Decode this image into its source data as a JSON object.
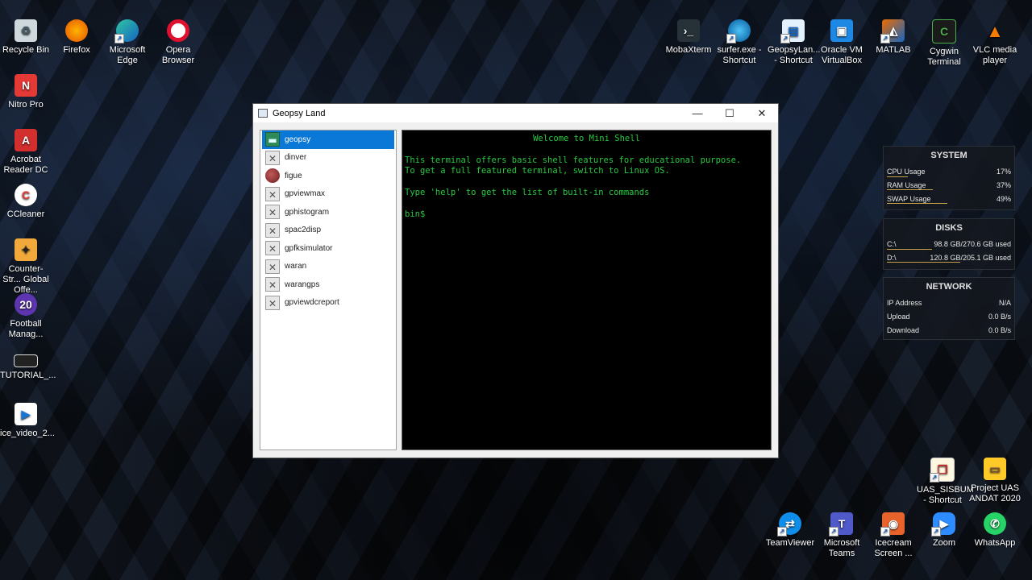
{
  "desktop_left": [
    {
      "label": "Recycle Bin",
      "icon": "recycle-bin-icon"
    },
    {
      "label": "Firefox",
      "icon": "firefox-icon"
    },
    {
      "label": "Microsoft Edge",
      "icon": "edge-icon"
    },
    {
      "label": "Opera Browser",
      "icon": "opera-icon"
    },
    {
      "label": "Nitro Pro",
      "icon": "nitro-icon"
    },
    {
      "label": "Acrobat Reader DC",
      "icon": "acrobat-icon"
    },
    {
      "label": "CCleaner",
      "icon": "ccleaner-icon"
    },
    {
      "label": "Counter-Str... Global Offe...",
      "icon": "csgo-icon"
    },
    {
      "label": "Football Manag...",
      "icon": "football-manager-icon"
    },
    {
      "label": "TUTORIAL_...",
      "icon": "video-file-icon"
    },
    {
      "label": "ice_video_2...",
      "icon": "video-file-icon"
    }
  ],
  "desktop_right": [
    {
      "label": "MobaXterm",
      "icon": "mobaxterm-icon"
    },
    {
      "label": "surfer.exe - Shortcut",
      "icon": "surfer-icon"
    },
    {
      "label": "GeopsyLan... - Shortcut",
      "icon": "geopsy-icon"
    },
    {
      "label": "Oracle VM VirtualBox",
      "icon": "virtualbox-icon"
    },
    {
      "label": "MATLAB",
      "icon": "matlab-icon"
    },
    {
      "label": "Cygwin Terminal",
      "icon": "cygwin-icon"
    },
    {
      "label": "VLC media player",
      "icon": "vlc-icon"
    },
    {
      "label": "UAS_SISBUM - Shortcut",
      "icon": "document-icon"
    },
    {
      "label": "Project UAS ANDAT 2020",
      "icon": "folder-icon"
    },
    {
      "label": "TeamViewer",
      "icon": "teamviewer-icon"
    },
    {
      "label": "Microsoft Teams",
      "icon": "teams-icon"
    },
    {
      "label": "Icecream Screen ...",
      "icon": "icecream-icon"
    },
    {
      "label": "Zoom",
      "icon": "zoom-icon"
    },
    {
      "label": "WhatsApp",
      "icon": "whatsapp-icon"
    }
  ],
  "window": {
    "title": "Geopsy Land",
    "minimize": "—",
    "maximize": "☐",
    "close": "✕",
    "apps": [
      {
        "label": "geopsy",
        "selected": true
      },
      {
        "label": "dinver"
      },
      {
        "label": "figue"
      },
      {
        "label": "gpviewmax"
      },
      {
        "label": "gphistogram"
      },
      {
        "label": "spac2disp"
      },
      {
        "label": "gpfksimulator"
      },
      {
        "label": "waran"
      },
      {
        "label": "warangps"
      },
      {
        "label": "gpviewdcreport"
      }
    ],
    "terminal": {
      "welcome": "Welcome to Mini Shell",
      "line1": "This terminal offers basic shell features for educational purpose.",
      "line2": "To get a full featured terminal, switch to Linux OS.",
      "line3": "Type 'help' to get the list of built-in commands",
      "prompt": "bin$"
    }
  },
  "widgets": {
    "system": {
      "title": "SYSTEM",
      "rows": [
        {
          "label": "CPU Usage",
          "value": "17%",
          "level": 0.17
        },
        {
          "label": "RAM Usage",
          "value": "37%",
          "level": 0.37
        },
        {
          "label": "SWAP Usage",
          "value": "49%",
          "level": 0.49
        }
      ]
    },
    "disks": {
      "title": "DISKS",
      "rows": [
        {
          "label": "C:\\",
          "value": "98.8 GB/270.6 GB used",
          "level": 0.365
        },
        {
          "label": "D:\\",
          "value": "120.8 GB/205.1 GB used",
          "level": 0.589
        }
      ]
    },
    "network": {
      "title": "NETWORK",
      "rows": [
        {
          "label": "IP Address",
          "value": "N/A"
        },
        {
          "label": "Upload",
          "value": "0.0 B/s"
        },
        {
          "label": "Download",
          "value": "0.0 B/s"
        }
      ]
    }
  },
  "colors": {
    "terminal_text": "#27c93f",
    "selection": "#0a78d7",
    "usage_bar": "#c9a04a"
  }
}
